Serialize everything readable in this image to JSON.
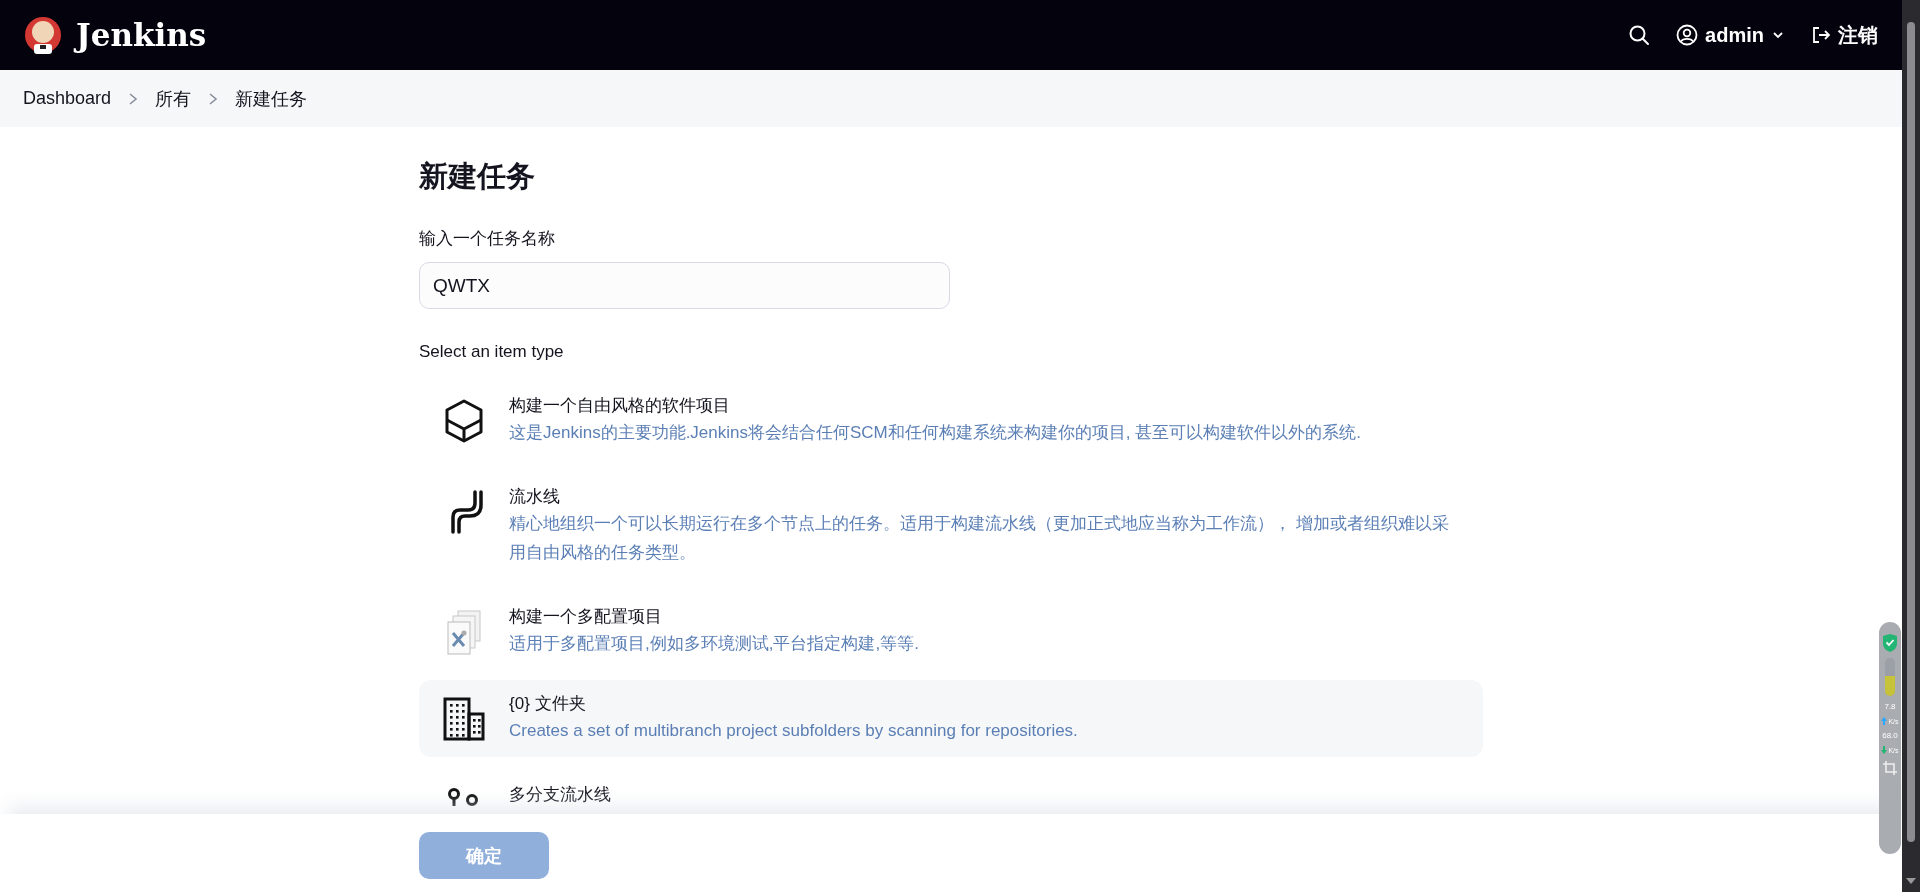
{
  "header": {
    "brand": "Jenkins",
    "user": "admin",
    "logout": "注销"
  },
  "breadcrumbs": [
    "Dashboard",
    "所有",
    "新建任务"
  ],
  "page_title": "新建任务",
  "name_field": {
    "label": "输入一个任务名称",
    "value": "QWTX"
  },
  "item_type_label": "Select an item type",
  "item_types": [
    {
      "kind": "freestyle",
      "title": "构建一个自由风格的软件项目",
      "description": "这是Jenkins的主要功能.Jenkins将会结合任何SCM和任何构建系统来构建你的项目, 甚至可以构建软件以外的系统.",
      "highlighted": false
    },
    {
      "kind": "pipeline",
      "title": "流水线",
      "description": "精心地组织一个可以长期运行在多个节点上的任务。适用于构建流水线（更加正式地应当称为工作流）， 增加或者组织难以采用自由风格的任务类型。",
      "highlighted": false
    },
    {
      "kind": "matrix",
      "title": "构建一个多配置项目",
      "description": "适用于多配置项目,例如多环境测试,平台指定构建,等等.",
      "highlighted": false
    },
    {
      "kind": "folder",
      "title": "{0} 文件夹",
      "description": "Creates a set of multibranch project subfolders by scanning for repositories.",
      "highlighted": true
    },
    {
      "kind": "multibranch",
      "title": "多分支流水线",
      "highlighted": false
    }
  ],
  "ok_button": {
    "label": "确定",
    "disabled": true
  },
  "monitor_widget": {
    "upload": "7.8",
    "upload_unit": "K/s",
    "download": "68.0",
    "download_unit": "K/s"
  }
}
